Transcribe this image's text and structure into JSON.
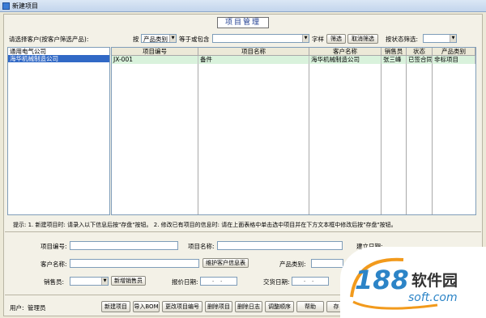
{
  "window": {
    "title": "新建项目"
  },
  "app_title": "项目管理",
  "filter_bar": {
    "customer_prompt": "请选择客户(按客户筛选产品):",
    "by_label": "按",
    "field_select": "产品类别",
    "op_label": "等于或包含",
    "value_input": "",
    "string_label": "字样",
    "filter_button": "筛选",
    "cancel_filter_button": "取消筛选",
    "status_filter_label": "按状态筛选:",
    "status_select": ""
  },
  "customers": [
    {
      "name": "通用电气公司",
      "selected": false
    },
    {
      "name": "海华机械制造公司",
      "selected": true
    }
  ],
  "grid": {
    "columns": [
      "项目编号",
      "项目名称",
      "客户名称",
      "销售员",
      "状态",
      "产品类别"
    ],
    "rows": [
      [
        "JX-001",
        "备件",
        "海华机械制造公司",
        "张三峰",
        "已签合同",
        "非标项目"
      ]
    ]
  },
  "hint": "提示: 1. 新建项目时: 请录入以下信息后按\"存盘\"按钮。   2. 修改已有项目的信息时: 请在上面表格中单击选中项目并在下方文本框中修改后按\"存盘\"按钮。",
  "form": {
    "project_no_label": "项目编号:",
    "project_no": "",
    "project_name_label": "项目名称:",
    "project_name": "",
    "created_label": "建立日期:",
    "customer_label": "客户名称:",
    "customer": "",
    "maintain_customer_button": "维护客户信息表",
    "category_label": "产品类别:",
    "salesperson_label": "销售员:",
    "salesperson": "",
    "add_salesperson_button": "新增销售员",
    "quote_date_label": "报价日期:",
    "quote_date": "- -",
    "delivery_date_label": "交货日期:",
    "delivery_date": "- -"
  },
  "footer": {
    "user_label": "用户:",
    "user": "管理员",
    "buttons": [
      "新建项目",
      "导入BOM",
      "更改项目编号",
      "删除项目",
      "删除日志",
      "调整顺序",
      "帮助",
      "存"
    ]
  },
  "watermark": {
    "brand_number": "188",
    "brand_text": "软件园",
    "domain": "soft.com"
  }
}
